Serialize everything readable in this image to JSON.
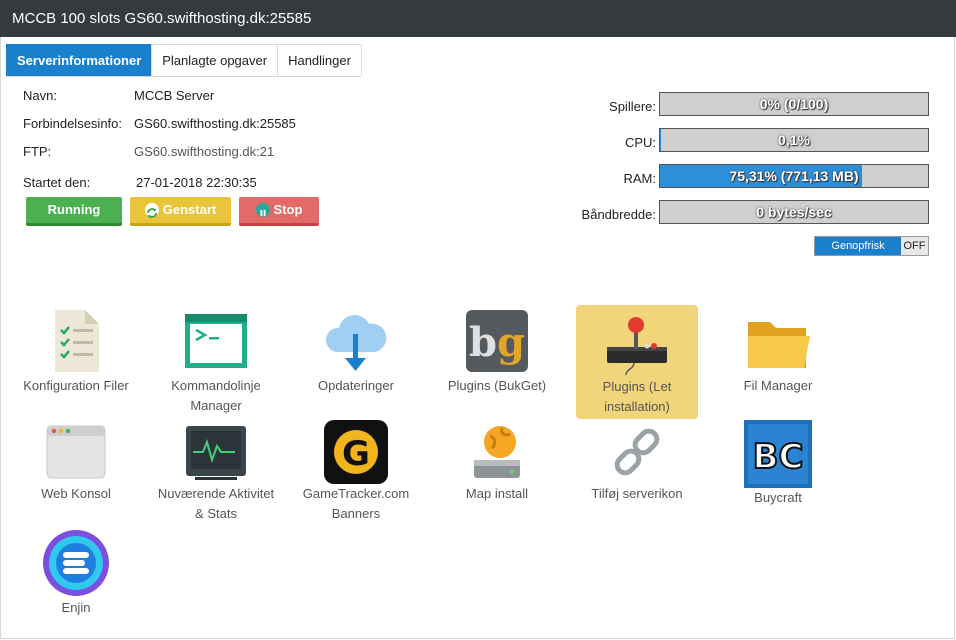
{
  "window": {
    "title": "MCCB 100 slots GS60.swifthosting.dk:25585"
  },
  "tabs": [
    {
      "label": "Serverinformationer",
      "active": true
    },
    {
      "label": "Planlagte opgaver",
      "active": false
    },
    {
      "label": "Handlinger",
      "active": false
    }
  ],
  "info": {
    "name_label": "Navn:",
    "name_value": "MCCB Server",
    "conn_label": "Forbindelsesinfo:",
    "conn_value": "GS60.swifthosting.dk:25585",
    "ftp_label": "FTP:",
    "ftp_value": "GS60.swifthosting.dk:21",
    "started_label": "Startet den:",
    "started_value": "27-01-2018 22:30:35"
  },
  "buttons": {
    "running": "Running",
    "restart": "Genstart",
    "stop": "Stop"
  },
  "stats": {
    "players_label": "Spillere:",
    "players_value": "0% (0/100)",
    "players_fraction": 0,
    "cpu_label": "CPU:",
    "cpu_value": "0,1%",
    "cpu_fraction": 0.001,
    "ram_label": "RAM:",
    "ram_value": "75,31% (771,13 MB)",
    "ram_fraction": 0.7531,
    "bw_label": "Båndbredde:",
    "bw_value": "0 bytes/sec",
    "bw_fraction": 0
  },
  "refresh_toggle": {
    "on_label": "Genopfrisk",
    "off_label": "OFF"
  },
  "tiles": {
    "config": "Konfiguration Filer",
    "cmd": "Kommandolinje Manager",
    "updates": "Opdateringer",
    "bukget": "Plugins (BukGet)",
    "plugins_easy": "Plugins (Let installation)",
    "filemanager": "Fil Manager",
    "webconsole": "Web Konsol",
    "activity": "Nuværende Aktivitet & Stats",
    "gametracker": "GameTracker.com Banners",
    "mapinstall": "Map install",
    "servericon": "Tilføj serverikon",
    "buycraft": "Buycraft",
    "enjin": "Enjin"
  },
  "colors": {
    "accent": "#1a7fcd",
    "titlebar": "#343a3e",
    "highlight": "#f2d57a"
  },
  "icons": [
    "checklist-doc-icon",
    "terminal-icon",
    "cloud-download-icon",
    "bukget-logo-icon",
    "joystick-icon",
    "folder-icon",
    "browser-window-icon",
    "activity-monitor-icon",
    "gametracker-logo-icon",
    "map-install-icon",
    "link-chain-icon",
    "buycraft-logo-icon",
    "enjin-logo-icon",
    "refresh-icon",
    "pause-icon"
  ]
}
